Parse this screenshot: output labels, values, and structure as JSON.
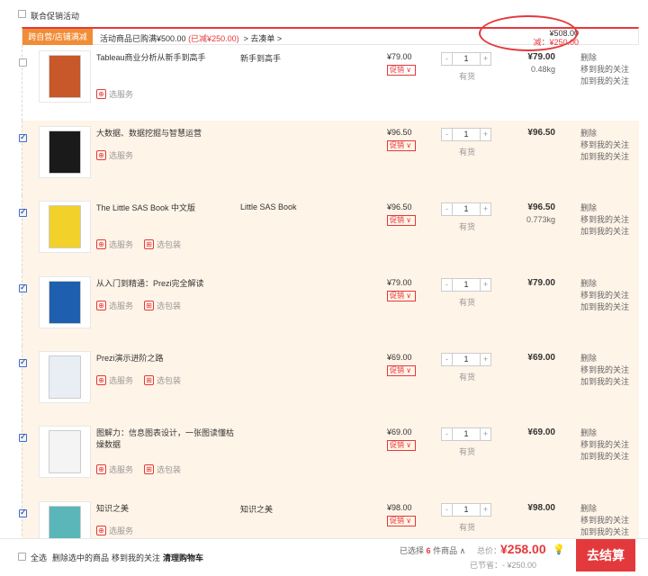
{
  "top": {
    "label": "联合促销活动"
  },
  "promo": {
    "tag": "跨自营/店铺满减",
    "text": "活动商品已购满¥500.00",
    "reduced": "(已减¥250.00)",
    "link": "> 去凑单 >",
    "sum": "¥508.00",
    "reduce": "减：¥250.00"
  },
  "labels": {
    "service": "选服务",
    "package": "选包装",
    "promo": "促销",
    "promo_arrow": "∨",
    "stock": "有货",
    "minus": "-",
    "plus": "+"
  },
  "ops": {
    "delete": "删除",
    "move": "移到我的关注",
    "follow": "加到我的关注"
  },
  "items": [
    {
      "title": "Tableau商业分析从新手到高手",
      "sub": "新手到高手",
      "price": "¥79.00",
      "qty": "1",
      "subtotal": "¥79.00",
      "weight": "0.48kg",
      "checked": false,
      "package": false,
      "cover": "#c8572a"
    },
    {
      "title": "大数据、数据挖掘与智慧运营",
      "sub": "",
      "price": "¥96.50",
      "qty": "1",
      "subtotal": "¥96.50",
      "weight": "",
      "checked": true,
      "package": false,
      "cover": "#1a1a1a"
    },
    {
      "title": "The Little SAS Book 中文版",
      "sub": "Little SAS Book",
      "price": "¥96.50",
      "qty": "1",
      "subtotal": "¥96.50",
      "weight": "0.773kg",
      "checked": true,
      "package": true,
      "cover": "#f2d12a"
    },
    {
      "title": "从入门到精通：Prezi完全解读",
      "sub": "",
      "price": "¥79.00",
      "qty": "1",
      "subtotal": "¥79.00",
      "weight": "",
      "checked": true,
      "package": true,
      "cover": "#1f5fb0"
    },
    {
      "title": "Prezi演示进阶之路",
      "sub": "",
      "price": "¥69.00",
      "qty": "1",
      "subtotal": "¥69.00",
      "weight": "",
      "checked": true,
      "package": true,
      "cover": "#e9eef5"
    },
    {
      "title": "图解力：信息图表设计，一张图读懂枯燥数据",
      "sub": "",
      "price": "¥69.00",
      "qty": "1",
      "subtotal": "¥69.00",
      "weight": "",
      "checked": true,
      "package": true,
      "cover": "#f4f4f4"
    },
    {
      "title": "知识之美",
      "sub": "知识之美",
      "price": "¥98.00",
      "qty": "1",
      "subtotal": "¥98.00",
      "weight": "",
      "checked": true,
      "package": false,
      "cover": "#5ab6b8"
    }
  ],
  "bottom": {
    "select_all": "全选",
    "delete_selected": "删除选中的商品",
    "move_follow": "移到我的关注",
    "clear": "清理购物车",
    "selected_prefix": "已选择",
    "selected_count": "6",
    "selected_suffix": "件商品 ∧",
    "total_label": "总价：",
    "total_value": "¥258.00",
    "saved": "已节省：- ¥250.00",
    "checkout": "去结算"
  }
}
